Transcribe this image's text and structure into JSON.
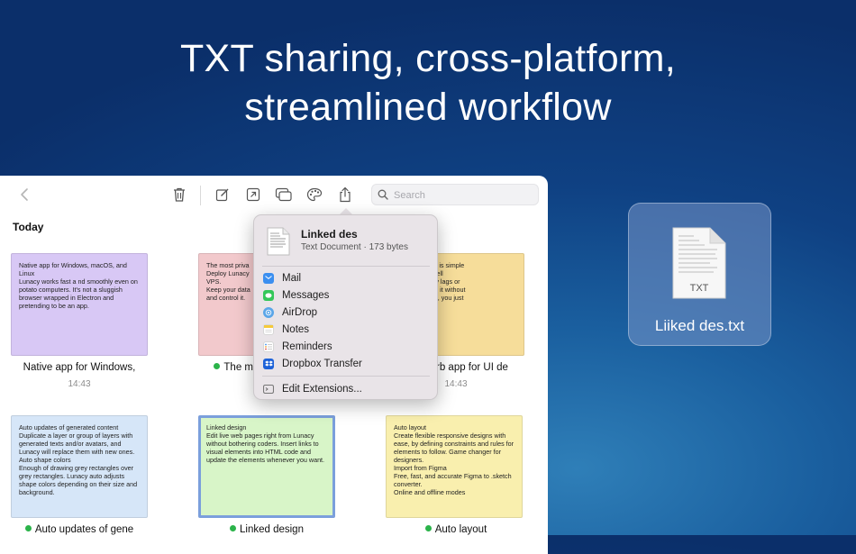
{
  "headline": {
    "line1": "TXT sharing, cross-platform,",
    "line2": "streamlined workflow"
  },
  "toolbar": {
    "search_placeholder": "Search"
  },
  "section_title": "Today",
  "cards": [
    {
      "text": "Native app for Windows, macOS, and Linux\nLunacy works fast a  nd smoothly even on potato computers. It's not a sluggish browser wrapped in Electron and pretending to be an app.",
      "caption": "Native app for Windows,",
      "time": "14:43",
      "color": "#d8c8f5",
      "dot": false
    },
    {
      "text": "The most priva\nDeploy Lunacy\nVPS.\nKeep your data\nand control it.",
      "caption": "The m",
      "time": "",
      "color": "#f2c9cc",
      "dot": true
    },
    {
      "text": "r UI designs. It is simple\nintuitive and well\nrks without any lags or\nr can jump into it without\nals and how-to, you just\ndone.",
      "caption": "rb app for UI de",
      "time": "14:43",
      "color": "#f6dd9a",
      "dot": false
    },
    {
      "text": "Auto updates of generated content\nDuplicate a layer or group of layers with generated texts and/or avatars, and Lunacy will replace them with new ones.\nAuto shape colors\nEnough of drawing grey rectangles over grey rectangles. Lunacy auto adjusts shape colors depending on their size and background.",
      "caption": "Auto updates of gene",
      "time": "",
      "color": "#d6e6f8",
      "dot": true
    },
    {
      "text": "Linked design\nEdit live web pages right from Lunacy without bothering coders. Insert links to visual elements into HTML code and update the elements whenever you want.",
      "caption": "Linked design",
      "time": "",
      "color": "#d8f5c8",
      "dot": true,
      "selected": true
    },
    {
      "text": "Auto layout\nCreate flexible responsive designs with ease, by defining constraints and rules for elements to follow. Game changer for designers.\nImport from Figma\nFree, fast, and accurate Figma to .sketch converter.\nOnline and offline modes",
      "caption": "Auto layout",
      "time": "",
      "color": "#f9efae",
      "dot": true
    }
  ],
  "share_menu": {
    "file_name": "Linked des",
    "file_meta": "Text Document · 173 bytes",
    "items": [
      {
        "label": "Mail",
        "icon": "mail-icon",
        "color": "#3b8ff0"
      },
      {
        "label": "Messages",
        "icon": "messages-icon",
        "color": "#34c759"
      },
      {
        "label": "AirDrop",
        "icon": "airdrop-icon",
        "color": "#5aa6e8"
      },
      {
        "label": "Notes",
        "icon": "notes-icon",
        "color": "#f5c93a"
      },
      {
        "label": "Reminders",
        "icon": "reminders-icon",
        "color": "#9a9a9a"
      },
      {
        "label": "Dropbox Transfer",
        "icon": "dropbox-icon",
        "color": "#1d62d8"
      }
    ],
    "extensions_label": "Edit Extensions..."
  },
  "file_tile": {
    "doc_label": "TXT",
    "file_name": "Liiked des.txt"
  }
}
